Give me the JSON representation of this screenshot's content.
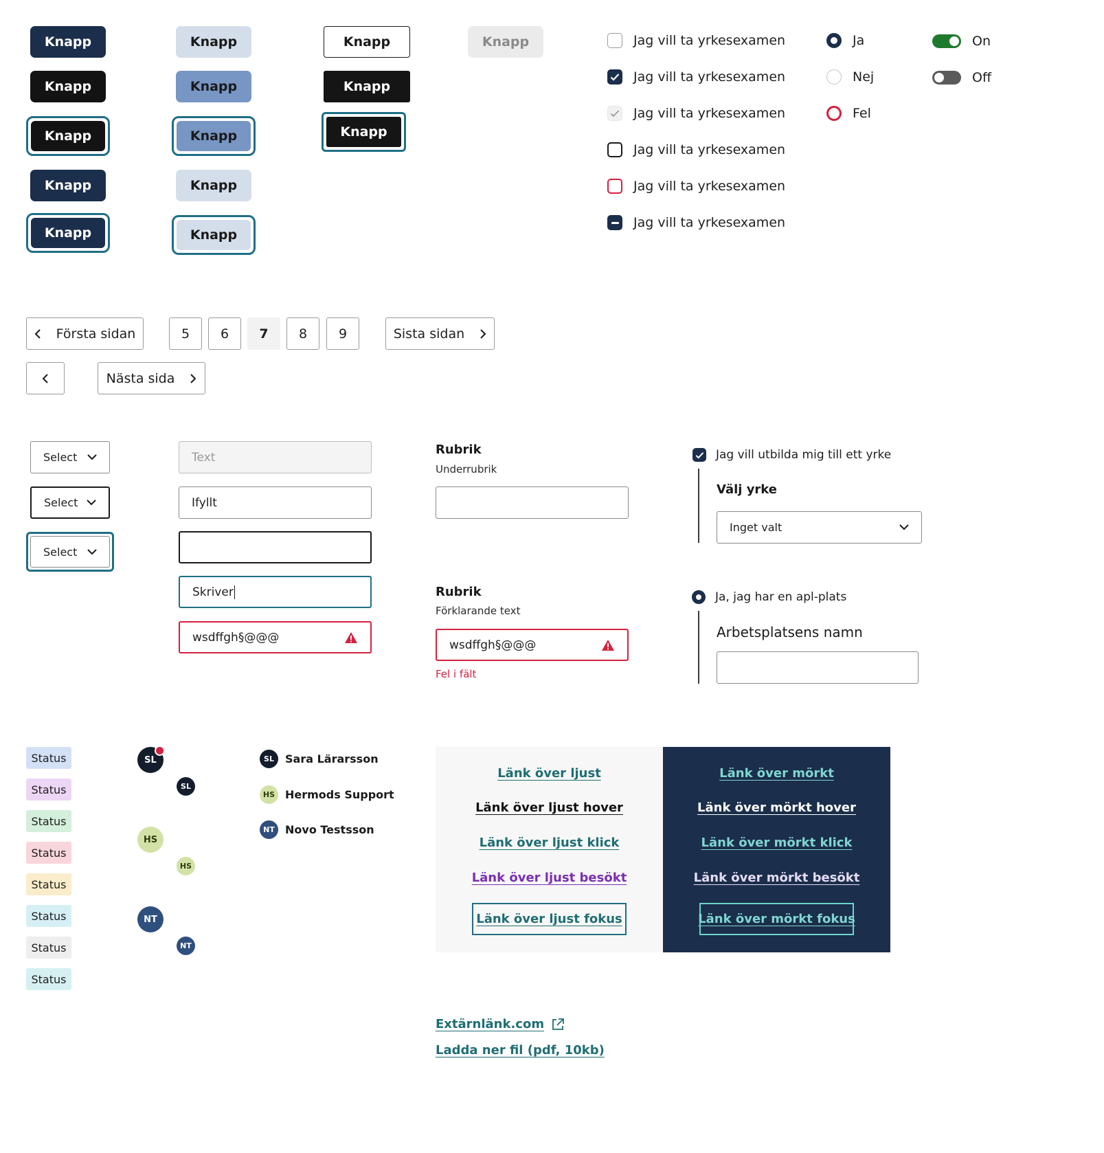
{
  "buttons": {
    "label": "Knapp"
  },
  "checkboxes": {
    "label": "Jag vill ta yrkesexamen"
  },
  "radios": {
    "yes": "Ja",
    "no": "Nej",
    "error": "Fel"
  },
  "toggles": {
    "on": "On",
    "off": "Off",
    "on_color": "#1f7a2e",
    "off_color": "#5a5a5a"
  },
  "pagination": {
    "first": "Första sidan",
    "last": "Sista sidan",
    "next": "Nästa sida",
    "pages": [
      "5",
      "6",
      "7",
      "8",
      "9"
    ],
    "current": "7"
  },
  "selects": {
    "label": "Select"
  },
  "inputs": {
    "disabled_placeholder": "Text",
    "filled": "Ifyllt",
    "typing": "Skriver",
    "error_value": "wsdffgh§@@@"
  },
  "fields": {
    "title": "Rubrik",
    "subtitle": "Underrubrik",
    "helper": "Förklarande text",
    "error_value": "wsdffgh§@@@",
    "error_msg": "Fel i fält"
  },
  "conditional": {
    "checkbox_label": "Jag vill utbilda mig till ett yrke",
    "select_label": "Välj yrke",
    "select_value": "Inget valt",
    "radio_label": "Ja, jag har en apl-plats",
    "input_label": "Arbetsplatsens namn"
  },
  "statuses": [
    {
      "label": "Status",
      "color": "#d3e1f7"
    },
    {
      "label": "Status",
      "color": "#ecd6f5"
    },
    {
      "label": "Status",
      "color": "#d4efdb"
    },
    {
      "label": "Status",
      "color": "#f9d6dc"
    },
    {
      "label": "Status",
      "color": "#fbedcb"
    },
    {
      "label": "Status",
      "color": "#d5eff5"
    },
    {
      "label": "Status",
      "color": "#eeeeee"
    },
    {
      "label": "Status",
      "color": "#d6f0f2"
    }
  ],
  "avatars": [
    {
      "initials": "SL",
      "name": "Sara Lärarsson",
      "bg": "#131d2c",
      "fg": "#ffffff"
    },
    {
      "initials": "HS",
      "name": "Hermods Support",
      "bg": "#d2e2a6",
      "fg": "#2f3d12"
    },
    {
      "initials": "NT",
      "name": "Novo Testsson",
      "bg": "#2f4f7e",
      "fg": "#ffffff"
    }
  ],
  "links_light": [
    "Länk över ljust",
    "Länk över ljust hover",
    "Länk över ljust klick",
    "Länk över ljust besökt",
    "Länk över ljust fokus"
  ],
  "links_dark": [
    "Länk över mörkt",
    "Länk över mörkt hover",
    "Länk över mörkt klick",
    "Länk över mörkt besökt",
    "Länk över mörkt fokus"
  ],
  "external_link": "Extärnlänk.com",
  "download_link": "Ladda ner fil (pdf, 10kb)",
  "colors": {
    "navy": "#1b2e4b",
    "teal_link": "#1f6e73",
    "visited": "#7a2fb3",
    "error": "#d3213f",
    "dark_link": "#7fd6d0"
  }
}
